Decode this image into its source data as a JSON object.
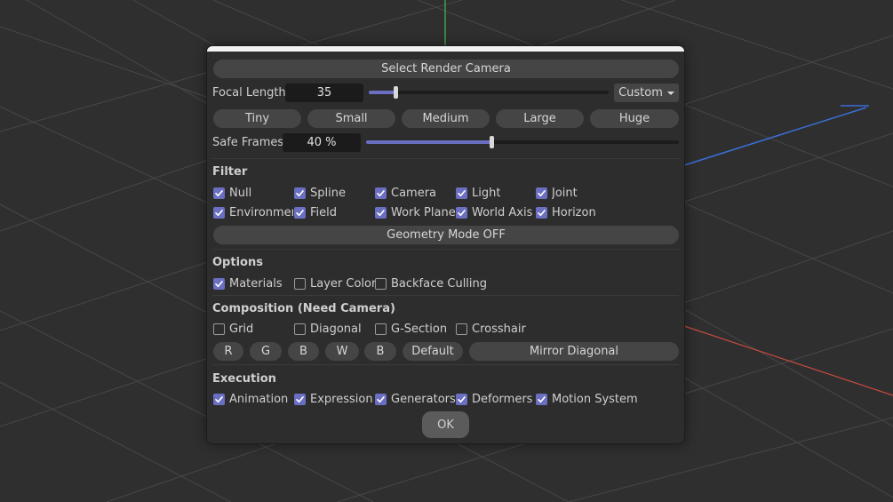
{
  "dialog": {
    "title_button": "Select Render Camera",
    "focal_length": {
      "label": "Focal Length",
      "value": "35",
      "slider_fraction": 0.11,
      "preset": "Custom"
    },
    "size_presets": [
      "Tiny",
      "Small",
      "Medium",
      "Large",
      "Huge"
    ],
    "safe_frames": {
      "label": "Safe Frames",
      "value": "40 %",
      "slider_fraction": 0.4
    },
    "filter": {
      "title": "Filter",
      "row1": [
        {
          "label": "Null",
          "checked": true
        },
        {
          "label": "Spline",
          "checked": true
        },
        {
          "label": "Camera",
          "checked": true
        },
        {
          "label": "Light",
          "checked": true
        },
        {
          "label": "Joint",
          "checked": true
        }
      ],
      "row2": [
        {
          "label": "Environment",
          "checked": true
        },
        {
          "label": "Field",
          "checked": true
        },
        {
          "label": "Work Plane",
          "checked": true
        },
        {
          "label": "World Axis",
          "checked": true
        },
        {
          "label": "Horizon",
          "checked": true
        }
      ],
      "geometry_button": "Geometry Mode OFF"
    },
    "options": {
      "title": "Options",
      "items": [
        {
          "label": "Materials",
          "checked": true
        },
        {
          "label": "Layer Color",
          "checked": false
        },
        {
          "label": "Backface Culling",
          "checked": false
        }
      ]
    },
    "composition": {
      "title": "Composition (Need Camera)",
      "items": [
        {
          "label": "Grid",
          "checked": false
        },
        {
          "label": "Diagonal",
          "checked": false
        },
        {
          "label": "G-Section",
          "checked": false
        },
        {
          "label": "Crosshair",
          "checked": false
        }
      ],
      "buttons": [
        "R",
        "G",
        "B",
        "W",
        "B",
        "Default"
      ],
      "mirror_button": "Mirror Diagonal"
    },
    "execution": {
      "title": "Execution",
      "items": [
        {
          "label": "Animation",
          "checked": true
        },
        {
          "label": "Expression",
          "checked": true
        },
        {
          "label": "Generators",
          "checked": true
        },
        {
          "label": "Deformers",
          "checked": true
        },
        {
          "label": "Motion System",
          "checked": true
        }
      ]
    },
    "ok_label": "OK"
  },
  "colors": {
    "accent": "#6a6fc2",
    "viewport_bg": "#2f2f2f",
    "grid_line": "#474747",
    "axis_y": "#3fbf5f",
    "axis_z": "#3a6fd8",
    "axis_x": "#c84a40"
  }
}
